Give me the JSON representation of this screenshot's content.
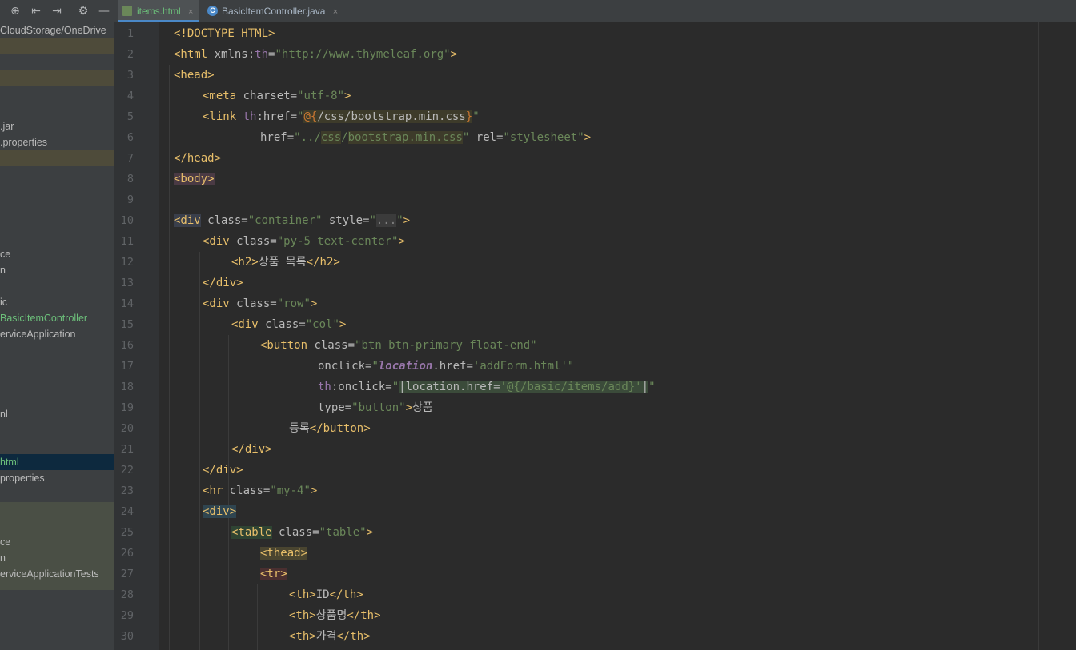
{
  "tabs": [
    {
      "label": "items.html",
      "close": "×",
      "icon": "html-file-icon"
    },
    {
      "label": "BasicItemController.java",
      "close": "×",
      "icon": "java-class-icon",
      "icon_glyph": "C"
    }
  ],
  "project_panel": {
    "toolbar_icons": [
      "⊕",
      "⇤",
      "⇥",
      "⚙",
      "—"
    ],
    "rows": [
      {
        "text": "CloudStorage/OneDrive"
      },
      {
        "text": ".jar"
      },
      {
        "text": ".properties"
      },
      {
        "text": "ce"
      },
      {
        "text": "n"
      },
      {
        "text": "ic"
      },
      {
        "text": "BasicItemController"
      },
      {
        "text": "erviceApplication"
      },
      {
        "text": "nl"
      },
      {
        "text": "html"
      },
      {
        "text": "properties"
      },
      {
        "text": "ce"
      },
      {
        "text": "n"
      },
      {
        "text": "erviceApplicationTests"
      }
    ]
  },
  "code": {
    "line_numbers": [
      "1",
      "2",
      "3",
      "4",
      "5",
      "6",
      "7",
      "8",
      "9",
      "10",
      "11",
      "12",
      "13",
      "14",
      "15",
      "16",
      "17",
      "18",
      "19",
      "20",
      "21",
      "22",
      "23",
      "24",
      "25",
      "26",
      "27",
      "28",
      "29",
      "30"
    ],
    "l1": {
      "doctype": "<!DOCTYPE HTML>"
    },
    "l2": {
      "open": "<html",
      "attr": " xmlns:",
      "ns": "th",
      "eq": "=",
      "val": "\"http://www.thymeleaf.org\"",
      "close": ">"
    },
    "l3": {
      "tag": "<head>"
    },
    "l4": {
      "open": "<meta",
      "attr": " charset=",
      "val": "\"utf-8\"",
      "close": ">"
    },
    "l5": {
      "open": "<link",
      "ns": " th",
      "attr": ":href=",
      "val1": "\"",
      "at": "@{",
      "path1": "/css/",
      "file": "bootstrap.min.css",
      "brace": "}",
      "val2": "\""
    },
    "l6": {
      "attr1": "href=",
      "val1": "\"../",
      "css": "css",
      "slash": "/",
      "file": "bootstrap.min.css",
      "val2": "\"",
      "attr2": " rel=",
      "val3": "\"stylesheet\"",
      "close": ">"
    },
    "l7": {
      "tag": "</head>"
    },
    "l8": {
      "tag": "<body>"
    },
    "l10": {
      "open": "<div",
      "attr": " class=",
      "val": "\"container\"",
      "attr2": " style=",
      "q1": "\"",
      "dots": "...",
      "q2": "\"",
      "close": ">"
    },
    "l11": {
      "open": "<div",
      "attr": " class=",
      "val": "\"py-5 text-center\"",
      "close": ">"
    },
    "l12": {
      "open": "<h2>",
      "text": "상품 목록",
      "close": "</h2>"
    },
    "l13": {
      "tag": "</div>"
    },
    "l14": {
      "open": "<div",
      "attr": " class=",
      "val": "\"row\"",
      "close": ">"
    },
    "l15": {
      "open": "<div",
      "attr": " class=",
      "val": "\"col\"",
      "close": ">"
    },
    "l16": {
      "open": "<button",
      "attr": " class=",
      "val": "\"btn btn-primary float-end\""
    },
    "l17": {
      "attr": "onclick=",
      "q1": "\"",
      "loc": "location",
      "dot": ".href=",
      "val": "'addForm.html'",
      "q2": "\""
    },
    "l18": {
      "ns": "th",
      "attr": ":onclick=",
      "q1": "\"",
      "bar1": "|",
      "expr": "location.href=",
      "val": "'@{/basic/items/add}'",
      "bar2": "|",
      "q2": "\""
    },
    "l19": {
      "attr": "type=",
      "val": "\"button\"",
      "close": ">",
      "text": "상품"
    },
    "l20": {
      "text": "등록",
      "close": "</button>"
    },
    "l21": {
      "tag": "</div>"
    },
    "l22": {
      "tag": "</div>"
    },
    "l23": {
      "open": "<hr",
      "attr": " class=",
      "val": "\"my-4\"",
      "close": ">"
    },
    "l24": {
      "tag": "<div>"
    },
    "l25": {
      "open": "<table",
      "attr": " class=",
      "val": "\"table\"",
      "close": ">"
    },
    "l26": {
      "tag": "<thead>"
    },
    "l27": {
      "tag": "<tr>"
    },
    "l28": {
      "open": "<th>",
      "text": "ID",
      "close": "</th>"
    },
    "l29": {
      "open": "<th>",
      "text": "상품명",
      "close": "</th>"
    },
    "l30": {
      "open": "<th>",
      "text": "가격",
      "close": "</th>"
    }
  }
}
